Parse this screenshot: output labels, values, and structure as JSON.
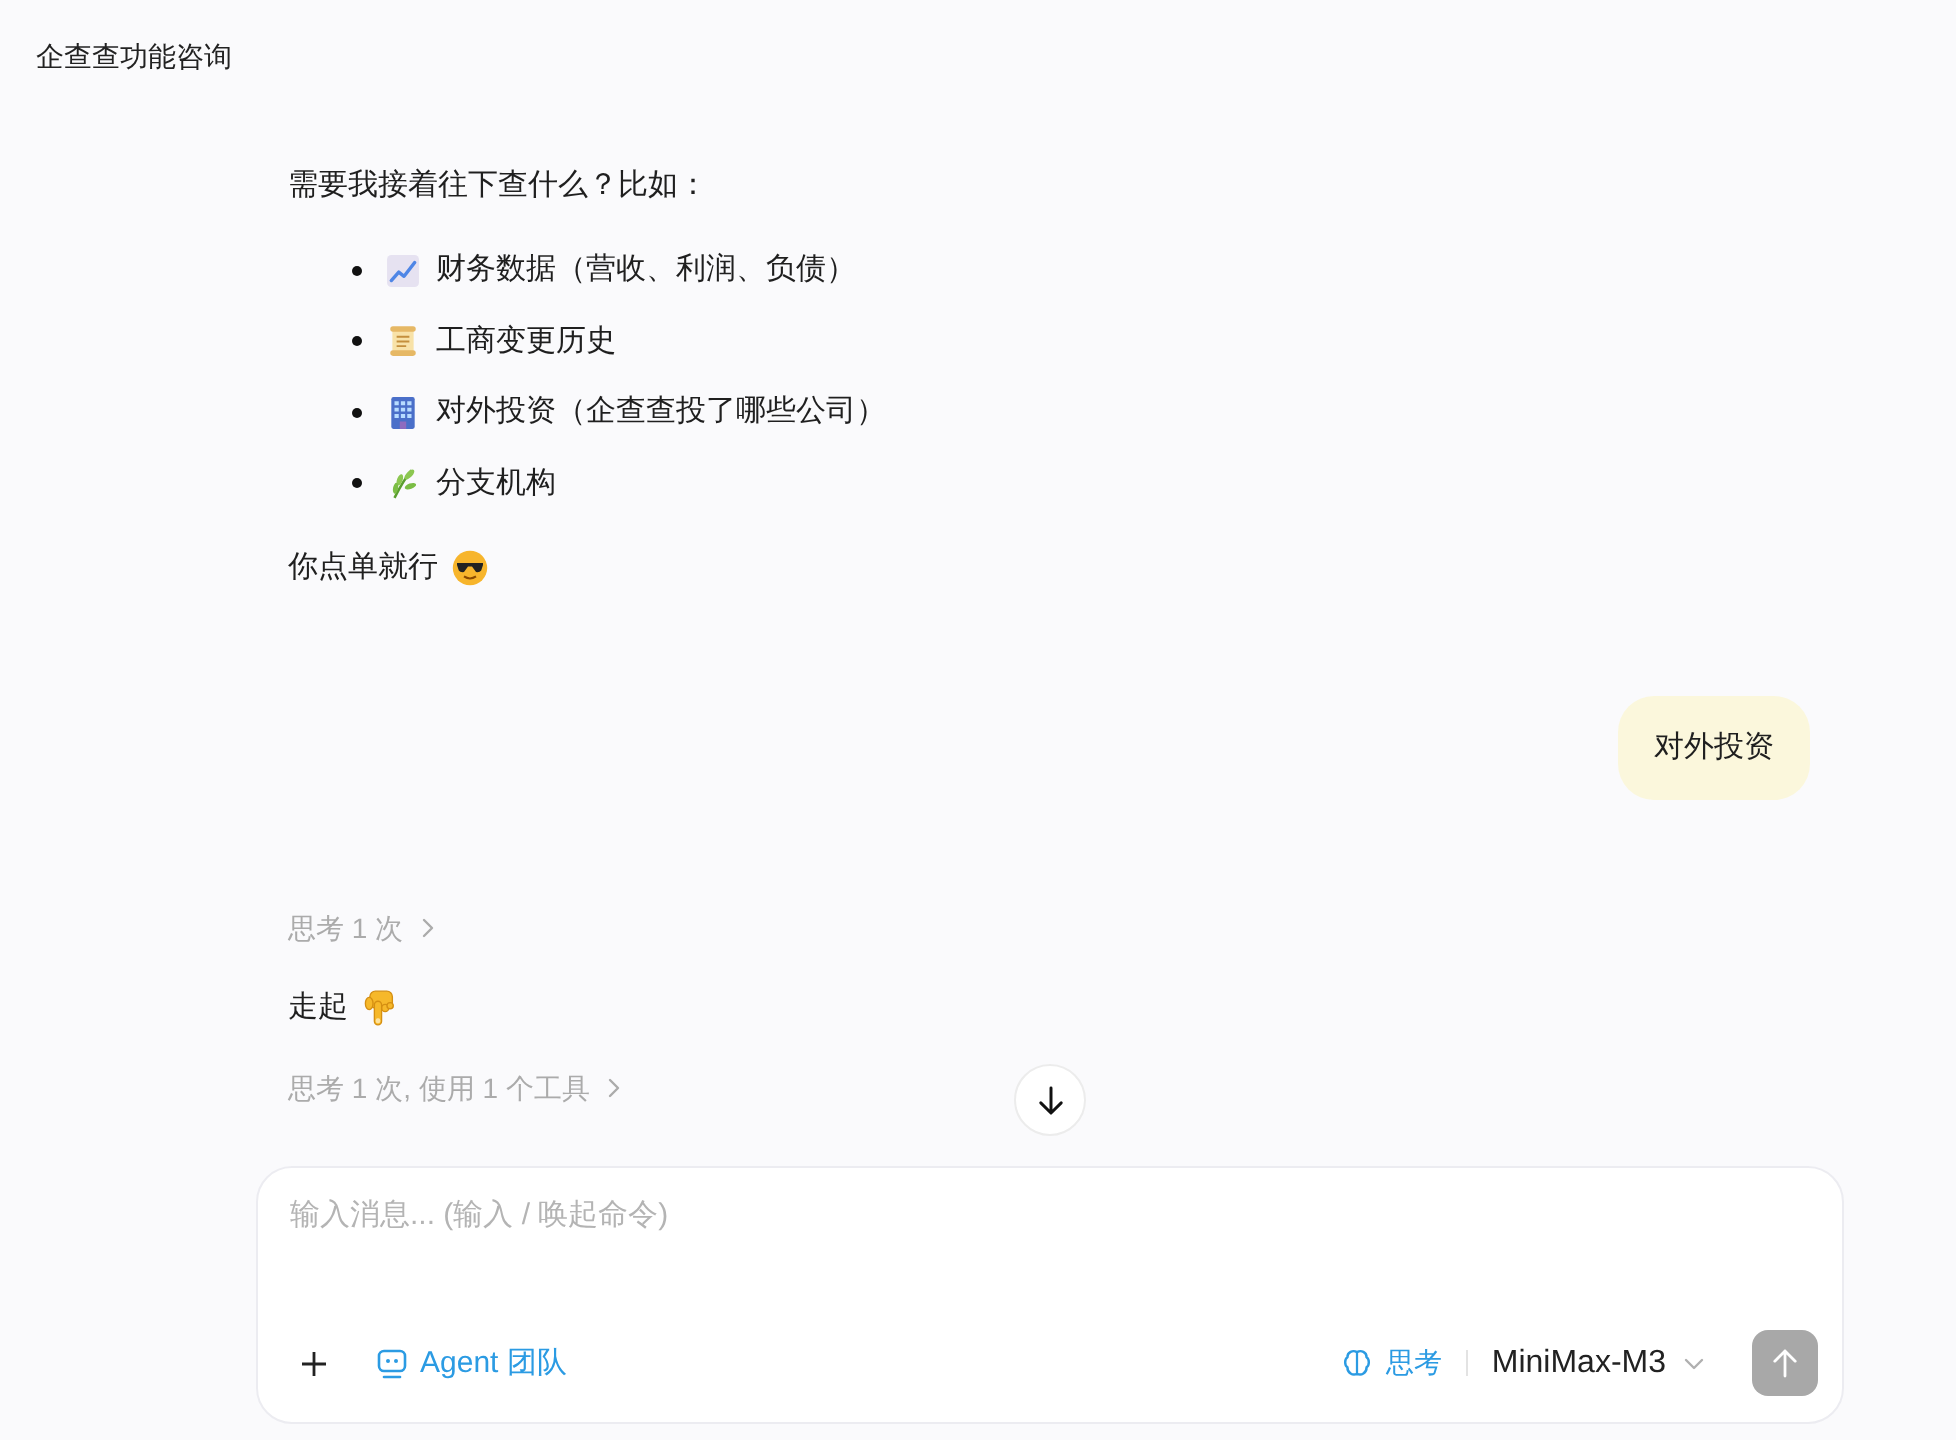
{
  "header": {
    "title": "企查查功能咨询"
  },
  "messages": [
    {
      "kind": "text",
      "text": "需要我接着往下查什么？比如："
    },
    {
      "kind": "list",
      "items": [
        {
          "text": "财务数据（营收、利润、负债）"
        },
        {
          "text": "工商变更历史"
        },
        {
          "text": "对外投资（企查查投了哪些公司）"
        },
        {
          "text": "分支机构"
        }
      ]
    },
    {
      "kind": "text",
      "text": "你点单就行"
    },
    {
      "kind": "user",
      "text": "对外投资"
    },
    {
      "kind": "thinking",
      "text": "思考 1 次",
      "expanded": false
    },
    {
      "kind": "text",
      "text": "走起"
    },
    {
      "kind": "thinking",
      "text": "思考 1 次, 使用 1 个工具",
      "expanded": false
    }
  ],
  "composer": {
    "placeholder": "输入消息... (输入 / 唤起命令)",
    "agent_team": "Agent 团队",
    "thinking": "思考",
    "model": "MiniMax-M3",
    "send": {
      "disabled": true
    }
  }
}
